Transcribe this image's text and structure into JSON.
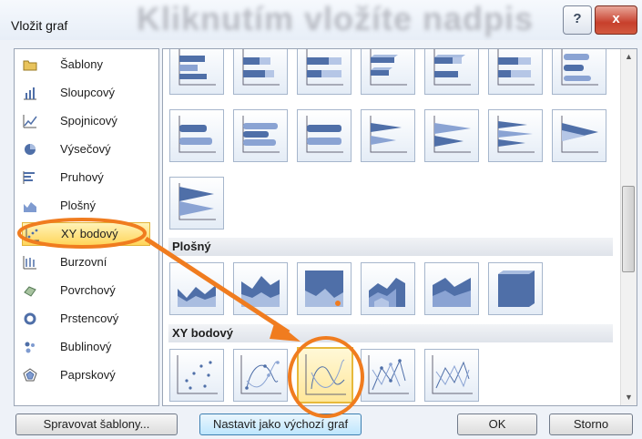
{
  "window": {
    "title": "Vložit graf",
    "watermark": "Kliknutím vložíte nadpis",
    "help_label": "?",
    "close_label": "x"
  },
  "categories": [
    {
      "label": "Šablony",
      "icon": "folder-icon"
    },
    {
      "label": "Sloupcový",
      "icon": "column-chart-icon"
    },
    {
      "label": "Spojnicový",
      "icon": "line-chart-icon"
    },
    {
      "label": "Výsečový",
      "icon": "pie-chart-icon"
    },
    {
      "label": "Pruhový",
      "icon": "bar-chart-icon"
    },
    {
      "label": "Plošný",
      "icon": "area-chart-icon"
    },
    {
      "label": "XY bodový",
      "icon": "scatter-chart-icon",
      "selected": true
    },
    {
      "label": "Burzovní",
      "icon": "stock-chart-icon"
    },
    {
      "label": "Povrchový",
      "icon": "surface-chart-icon"
    },
    {
      "label": "Prstencový",
      "icon": "doughnut-chart-icon"
    },
    {
      "label": "Bublinový",
      "icon": "bubble-chart-icon"
    },
    {
      "label": "Paprskový",
      "icon": "radar-chart-icon"
    }
  ],
  "sections": [
    {
      "label": "Plošný"
    },
    {
      "label": "XY bodový"
    }
  ],
  "buttons": {
    "manage_templates": "Spravovat šablony...",
    "set_default": "Nastavit jako výchozí graf",
    "ok": "OK",
    "cancel": "Storno"
  },
  "colors": {
    "accent": "#f07c1f",
    "selection": "#ffd55a",
    "chart_blue": "#4f6fa8"
  }
}
